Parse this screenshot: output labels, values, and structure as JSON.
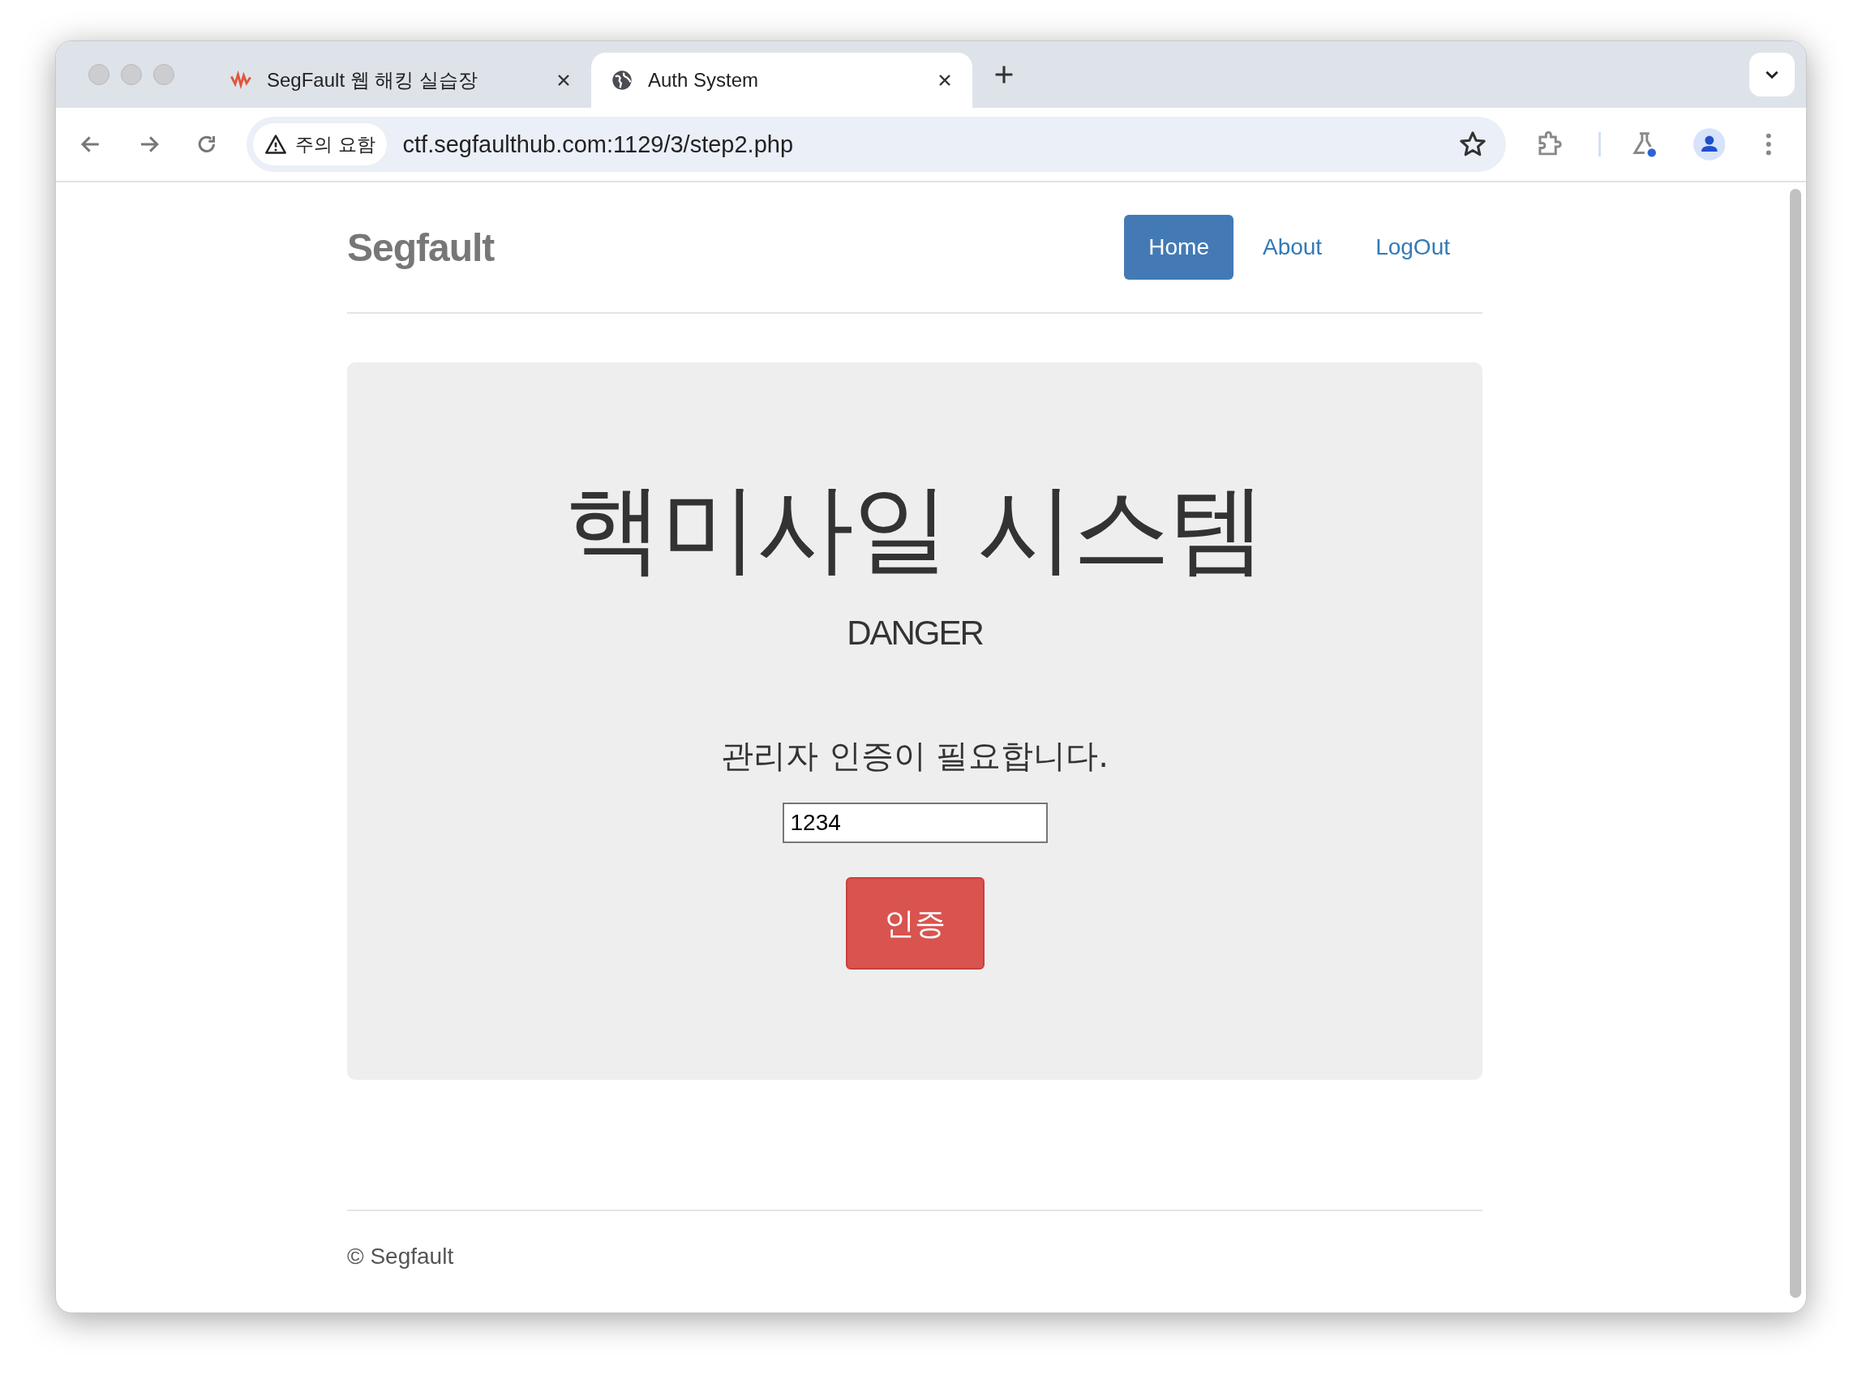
{
  "browser": {
    "tabs": [
      {
        "title": "SegFault 웹 해킹 실습장",
        "selected": false
      },
      {
        "title": "Auth System",
        "selected": true
      }
    ],
    "security_chip": "주의 요함",
    "url": "ctf.segfaulthub.com:1129/3/step2.php"
  },
  "navbar": {
    "brand": "Segfault",
    "links": [
      {
        "label": "Home",
        "selected": true
      },
      {
        "label": "About",
        "selected": false
      },
      {
        "label": "LogOut",
        "selected": false
      }
    ]
  },
  "jumbotron": {
    "title": "핵미사일 시스템",
    "subtitle": "DANGER",
    "prompt": "관리자 인증이 필요합니다.",
    "input_value": "1234",
    "button": "인증"
  },
  "footer": "© Segfault"
}
